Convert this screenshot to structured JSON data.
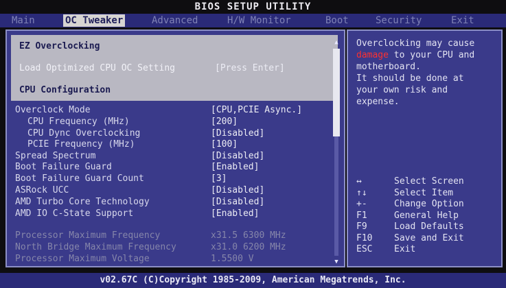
{
  "title": "BIOS SETUP UTILITY",
  "menu": [
    "Main",
    "OC Tweaker",
    "Advanced",
    "H/W Monitor",
    "Boot",
    "Security",
    "Exit"
  ],
  "settings": {
    "ez_overclocking": "EZ Overclocking",
    "load_optimized": {
      "label": "Load Optimized CPU OC Setting",
      "value": "[Press Enter]"
    },
    "cpu_configuration": "CPU Configuration",
    "items": [
      {
        "label": "Overclock Mode",
        "value": "[CPU,PCIE Async.]"
      },
      {
        "label": "CPU Frequency (MHz)",
        "value": "[200]"
      },
      {
        "label": "CPU Dync Overclocking",
        "value": "[Disabled]"
      },
      {
        "label": "PCIE Frequency (MHz)",
        "value": "[100]"
      },
      {
        "label": "Spread Spectrum",
        "value": "[Disabled]"
      },
      {
        "label": "Boot Failure Guard",
        "value": "[Enabled]"
      },
      {
        "label": "Boot Failure Guard Count",
        "value": "[3]"
      },
      {
        "label": "ASRock UCC",
        "value": "[Disabled]"
      },
      {
        "label": "AMD Turbo Core Technology",
        "value": "[Disabled]"
      },
      {
        "label": "AMD IO C-State Support",
        "value": "[Enabled]"
      }
    ],
    "info": [
      {
        "label": "Processor Maximum Frequency",
        "value": "x31.5 6300 MHz"
      },
      {
        "label": "North Bridge Maximum Frequency",
        "value": "x31.0 6200 MHz"
      },
      {
        "label": "Processor Maximum Voltage",
        "value": "1.5500 V"
      }
    ]
  },
  "help": {
    "line1": "Overclocking may cause",
    "warn": "damage",
    "line2_rest": " to your CPU and",
    "line3": "motherboard.",
    "line4": "It should be done at",
    "line5": "your own risk and",
    "line6": "expense."
  },
  "keys": [
    {
      "key": "↔",
      "desc": "Select Screen"
    },
    {
      "key": "↑↓",
      "desc": "Select Item"
    },
    {
      "key": "+-",
      "desc": "Change Option"
    },
    {
      "key": "F1",
      "desc": "General Help"
    },
    {
      "key": "F9",
      "desc": "Load Defaults"
    },
    {
      "key": "F10",
      "desc": "Save and Exit"
    },
    {
      "key": "ESC",
      "desc": "Exit"
    }
  ],
  "footer": "v02.67C (C)Copyright 1985-2009, American Megatrends, Inc."
}
